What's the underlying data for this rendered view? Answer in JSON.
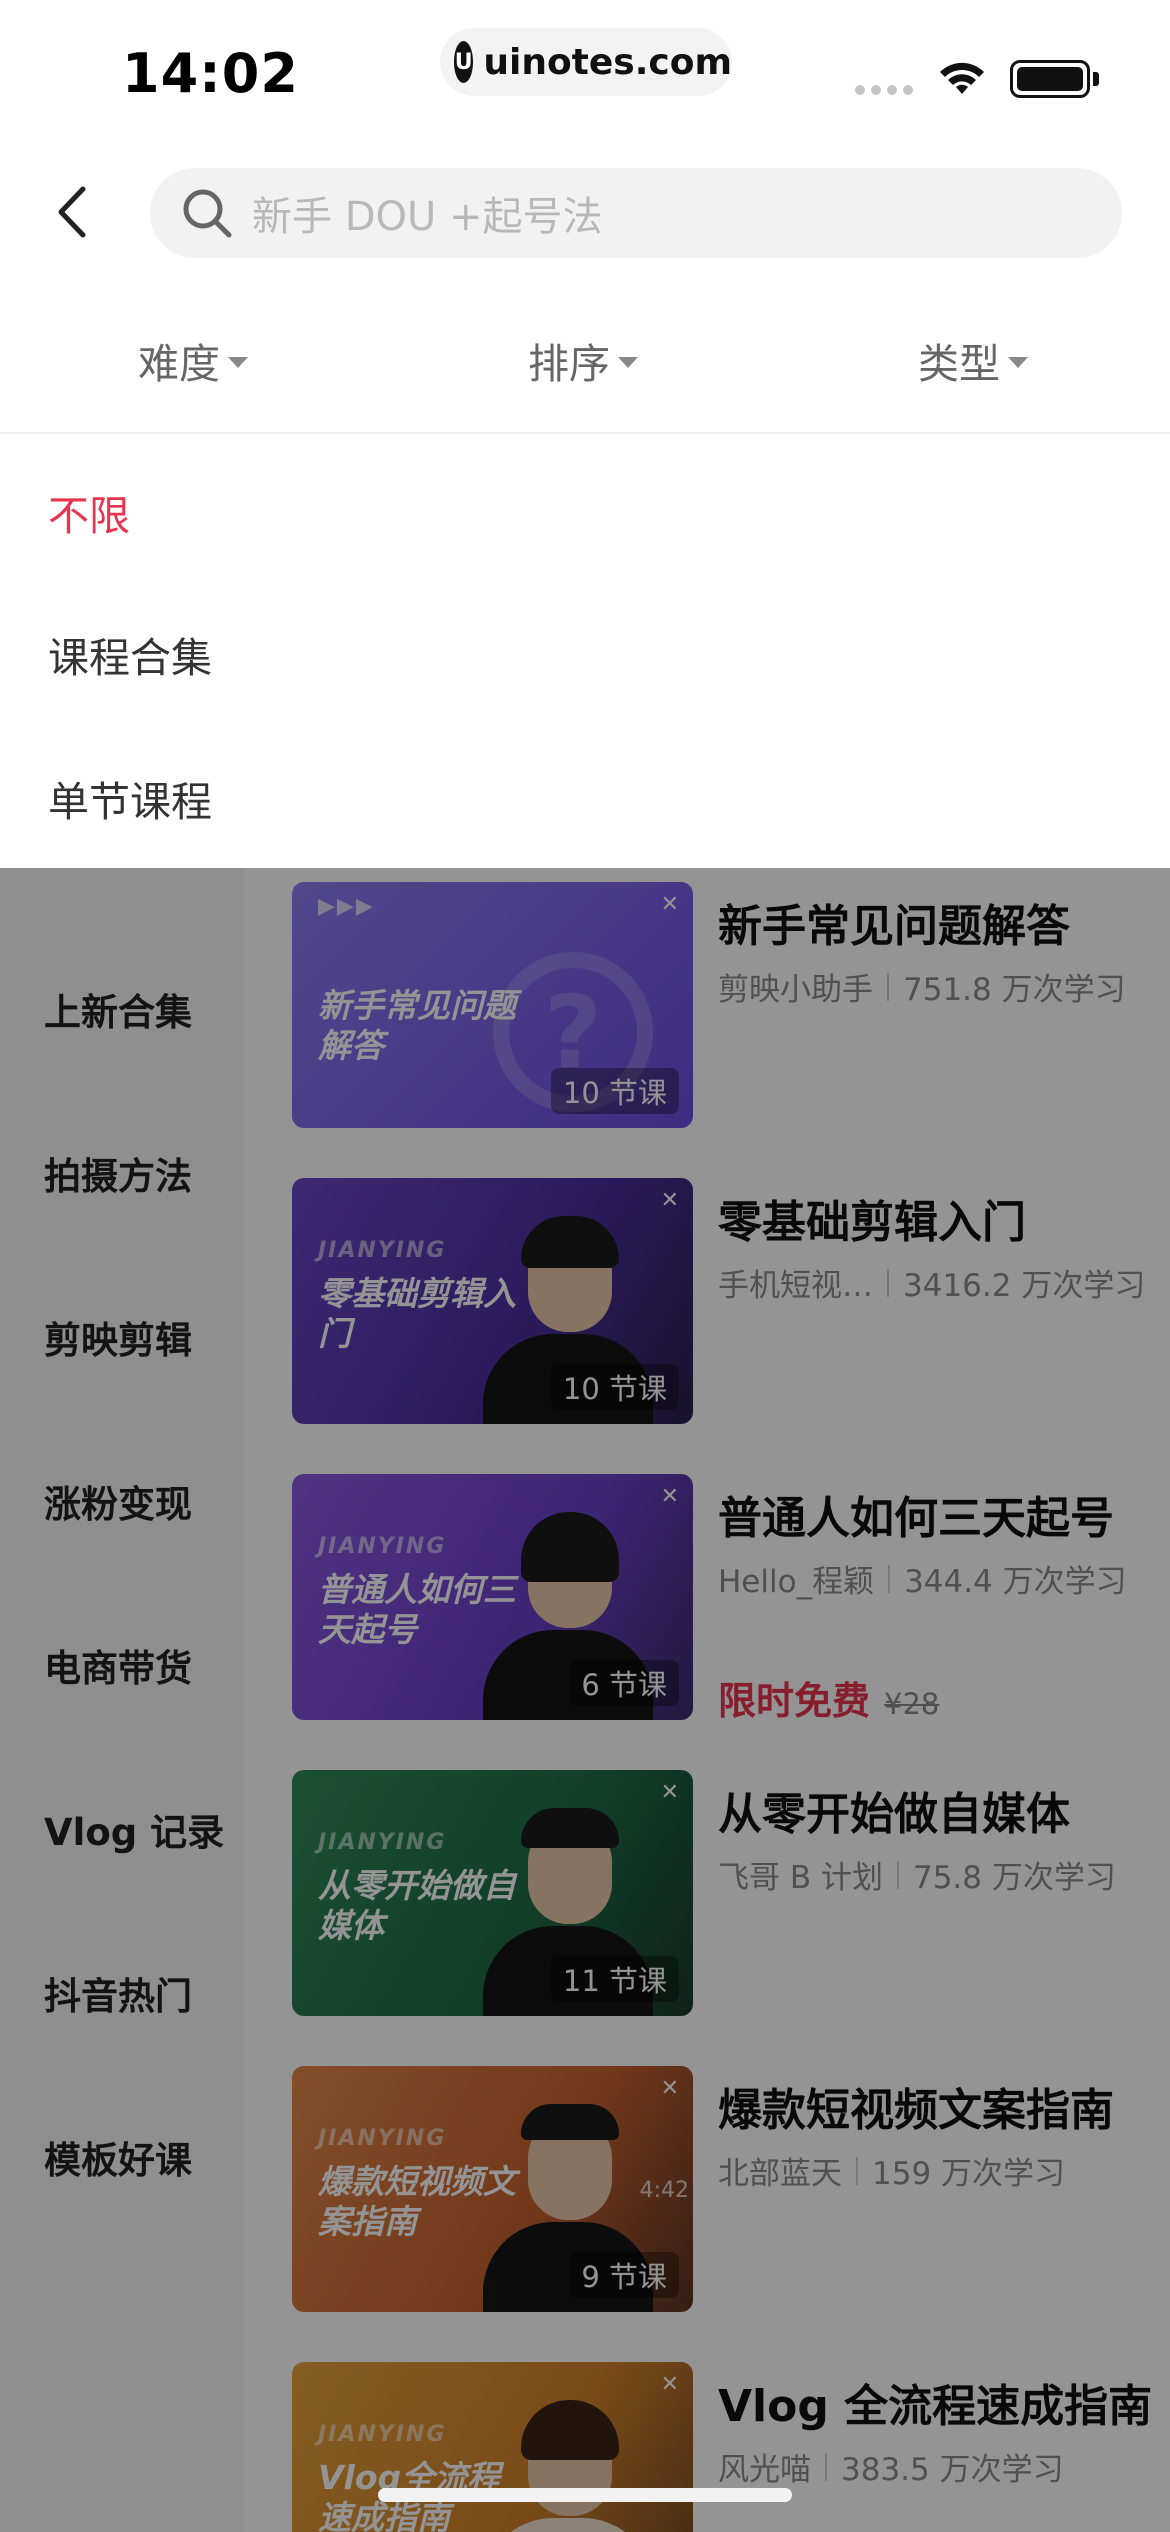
{
  "status": {
    "time": "14:02",
    "url": "uinotes.com",
    "url_logo_icon": "u-logo-icon"
  },
  "search": {
    "placeholder": "新手 DOU +起号法"
  },
  "filters": [
    {
      "label": "难度"
    },
    {
      "label": "排序"
    },
    {
      "label": "类型"
    }
  ],
  "dropdown": {
    "options": [
      {
        "label": "不限",
        "selected": true
      },
      {
        "label": "课程合集",
        "selected": false
      },
      {
        "label": "单节课程",
        "selected": false
      }
    ]
  },
  "sidebar": {
    "items": [
      {
        "label": "上新合集"
      },
      {
        "label": "拍摄方法"
      },
      {
        "label": "剪映剪辑"
      },
      {
        "label": "涨粉变现"
      },
      {
        "label": "电商带货"
      },
      {
        "label": "Vlog 记录"
      },
      {
        "label": "抖音热门"
      },
      {
        "label": "模板好课"
      }
    ]
  },
  "courses": [
    {
      "title": "新手常见问题解答",
      "author": "剪映小助手",
      "learners": "751.8 万次学习",
      "lessons": "10 节课",
      "thumb_title": "新手常见问题解答",
      "thumb_brand": ""
    },
    {
      "title": "零基础剪辑入门",
      "author": "手机短视…",
      "learners": "3416.2 万次学习",
      "lessons": "10 节课",
      "thumb_title": "零基础剪辑入门",
      "thumb_brand": "JIANYING"
    },
    {
      "title": "普通人如何三天起号",
      "author": "Hello_程颖",
      "learners": "344.4 万次学习",
      "lessons": "6 节课",
      "thumb_title": "普通人如何三天起号",
      "thumb_brand": "JIANYING",
      "promo": "限时免费",
      "price": "¥28"
    },
    {
      "title": "从零开始做自媒体",
      "author": "飞哥 B 计划",
      "learners": "75.8 万次学习",
      "lessons": "11 节课",
      "thumb_title": "从零开始做自媒体",
      "thumb_brand": "JIANYING"
    },
    {
      "title": "爆款短视频文案指南",
      "author": "北部蓝天",
      "learners": "159 万次学习",
      "lessons": "9 节课",
      "thumb_title": "爆款短视频文案指南",
      "thumb_brand": "JIANYING",
      "thumb_extra": "4:42"
    },
    {
      "title": "Vlog 全流程速成指南",
      "author": "风光喵",
      "learners": "383.5 万次学习",
      "lessons": "",
      "thumb_title": "Vlog全流程速成指南",
      "thumb_brand": "JIANYING"
    }
  ],
  "colors": {
    "accent": "#e8344e",
    "overlay": "rgba(0,0,0,0.42)"
  }
}
